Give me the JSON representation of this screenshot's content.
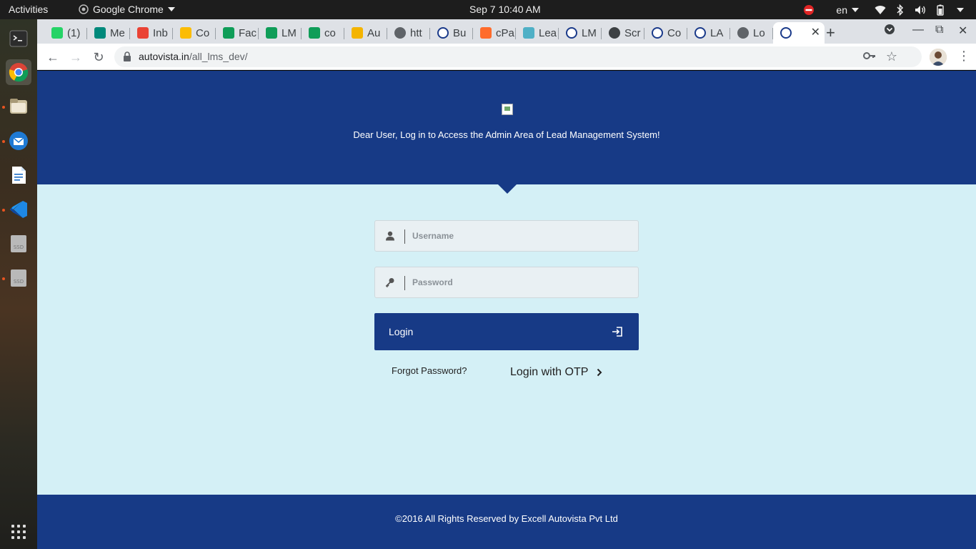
{
  "topbar": {
    "activities": "Activities",
    "app_name": "Google Chrome",
    "clock": "Sep 7  10:40 AM",
    "language": "en"
  },
  "browser": {
    "tabs": [
      {
        "label": "(1)",
        "icon": "whatsapp-icon",
        "color": "#25d366"
      },
      {
        "label": "Me",
        "icon": "meet-icon",
        "color": "#00897b"
      },
      {
        "label": "Inb",
        "icon": "gmail-icon",
        "color": "#ea4335"
      },
      {
        "label": "Co",
        "icon": "drive-icon",
        "color": "#fbbc04"
      },
      {
        "label": "Fac",
        "icon": "sheets-icon",
        "color": "#0f9d58"
      },
      {
        "label": "LM",
        "icon": "sheets-icon",
        "color": "#0f9d58"
      },
      {
        "label": "co",
        "icon": "sheets-icon",
        "color": "#0f9d58"
      },
      {
        "label": "Au",
        "icon": "slides-icon",
        "color": "#f4b400"
      },
      {
        "label": "htt",
        "icon": "globe-icon",
        "color": "#5f6368"
      },
      {
        "label": "Bu",
        "icon": "autovista-icon",
        "color": "#1a3a8a"
      },
      {
        "label": "cPa",
        "icon": "cpanel-icon",
        "color": "#ff6c2c"
      },
      {
        "label": "Lea",
        "icon": "eye-icon",
        "color": "#4fb0c6"
      },
      {
        "label": "LM",
        "icon": "autovista-icon",
        "color": "#1a3a8a"
      },
      {
        "label": "Scr",
        "icon": "smiley-icon",
        "color": "#3c4043"
      },
      {
        "label": "Co",
        "icon": "stopwatch-icon",
        "color": "#1a3a8a"
      },
      {
        "label": "LA",
        "icon": "stopwatch-icon",
        "color": "#1a3a8a"
      },
      {
        "label": "Lo",
        "icon": "globe-icon",
        "color": "#5f6368"
      },
      {
        "label": "",
        "icon": "autovista-icon",
        "color": "#1a3a8a",
        "active": true
      }
    ],
    "url_host": "autovista.in",
    "url_path": "/all_lms_dev/"
  },
  "page": {
    "header_message": "Dear User, Log in to Access the Admin Area of Lead Management System!",
    "username_placeholder": "Username",
    "password_placeholder": "Password",
    "login_label": "Login",
    "forgot_label": "Forgot Password?",
    "otp_label": "Login with OTP",
    "footer_text": "©2016 All Rights Reserved by Excell Autovista Pvt Ltd"
  },
  "colors": {
    "brand_navy": "#173a86",
    "page_background": "#d4f0f6"
  }
}
